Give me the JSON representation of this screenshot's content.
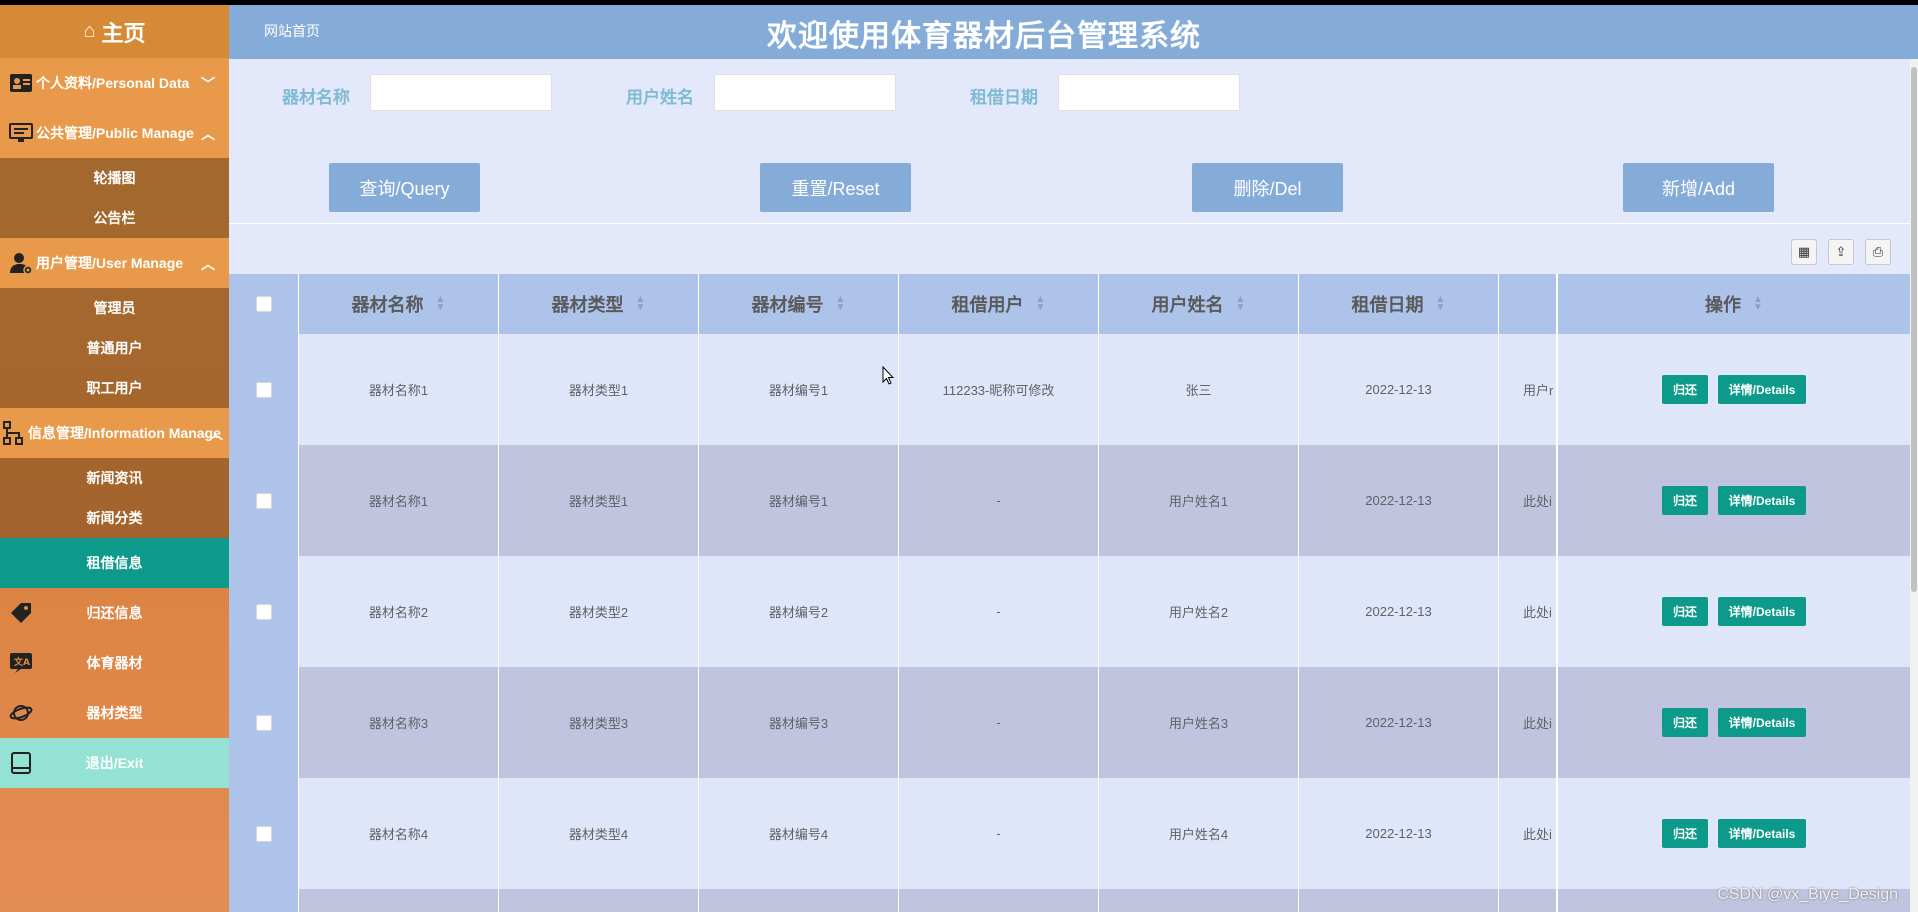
{
  "sidebar": {
    "home": "主页",
    "groups": [
      {
        "label": "个人资料/Personal Data",
        "items": []
      },
      {
        "label": "公共管理/Public Manage",
        "items": [
          "轮播图",
          "公告栏"
        ]
      },
      {
        "label": "用户管理/User Manage",
        "items": [
          "管理员",
          "普通用户",
          "职工用户"
        ]
      },
      {
        "label": "信息管理/Information Manage",
        "items": [
          "新闻资讯",
          "新闻分类"
        ]
      }
    ],
    "flat": [
      "租借信息",
      "归还信息",
      "体育器材",
      "器材类型",
      "退出/Exit"
    ]
  },
  "header": {
    "crumb": "网站首页",
    "title": "欢迎使用体育器材后台管理系统"
  },
  "search": {
    "fields": [
      "器材名称",
      "用户姓名",
      "租借日期"
    ],
    "buttons": [
      "查询/Query",
      "重置/Reset",
      "删除/Del",
      "新增/Add"
    ]
  },
  "table": {
    "columns": [
      "器材名称",
      "器材类型",
      "器材编号",
      "租借用户",
      "用户姓名",
      "租借日期",
      "操作"
    ],
    "rows": [
      [
        "器材名称1",
        "器材类型1",
        "器材编号1",
        "112233-昵称可修改",
        "张三",
        "2022-12-13",
        "用户r"
      ],
      [
        "器材名称1",
        "器材类型1",
        "器材编号1",
        "-",
        "用户姓名1",
        "2022-12-13",
        "此处i"
      ],
      [
        "器材名称2",
        "器材类型2",
        "器材编号2",
        "-",
        "用户姓名2",
        "2022-12-13",
        "此处i"
      ],
      [
        "器材名称3",
        "器材类型3",
        "器材编号3",
        "-",
        "用户姓名3",
        "2022-12-13",
        "此处i"
      ],
      [
        "器材名称4",
        "器材类型4",
        "器材编号4",
        "-",
        "用户姓名4",
        "2022-12-13",
        "此处i"
      ]
    ],
    "actions": {
      "return": "归还",
      "details": "详情/Details"
    }
  },
  "watermark": "CSDN @vx_Biye_Design",
  "colors": {
    "header": "#85acd8",
    "accent": "#0e9a8a",
    "sidebar": "#db8c43"
  }
}
